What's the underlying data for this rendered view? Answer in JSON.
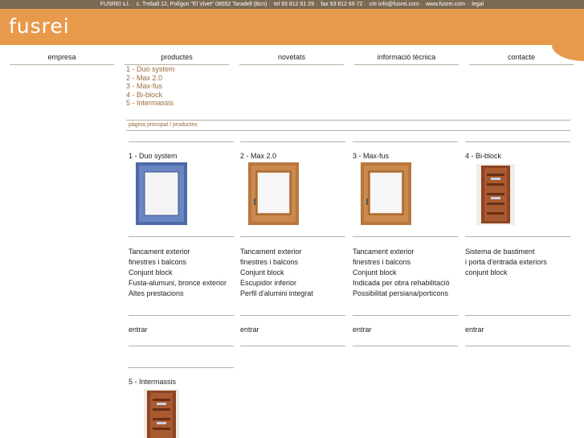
{
  "topbar": {
    "company": "FUSREI s.l.",
    "address": "c. Treball 12, Polígon \"El Vivet\" 08552 Taradell (Bcn)",
    "phone": "tel 93 812 61 29",
    "fax": "fax 93 812 69 72",
    "email": "c/e info@fusrei.com",
    "web": "www.fusrei.com",
    "legal": "legal"
  },
  "logo": "fusrei",
  "nav": [
    "empresa",
    "productes",
    "novetats",
    "informació tècnica",
    "contacte"
  ],
  "submenu": [
    "1 - Duo system",
    "2 - Max 2.0",
    "3 - Max-fus",
    "4 - Bi-block",
    "5 - Intermassis"
  ],
  "breadcrumb": "pàgina principal / productes",
  "products": [
    {
      "title": "1 - Duo system",
      "desc": [
        "Tancament exterior",
        "finestres i balcons",
        "Conjunt block",
        "Fusta-alumuni, bronce exterior",
        "Altes prestacions"
      ],
      "enter": "entrar",
      "image": "window-blue"
    },
    {
      "title": "2 - Max 2.0",
      "desc": [
        "Tancament exterior",
        "finestres i balcons",
        "Conjunt block",
        "Escupidor inferior",
        "Perfil d'alumini integrat"
      ],
      "enter": "entrar",
      "image": "window-wood"
    },
    {
      "title": "3 - Max-fus",
      "desc": [
        "Tancament exterior",
        "finestres i balcons",
        "Conjunt block",
        "Indicada per obra rehabilitació",
        "Possibilitat persiana/porticons"
      ],
      "enter": "entrar",
      "image": "window-wood"
    },
    {
      "title": "4 - Bi-block",
      "desc": [
        "Sistema de bastiment",
        "i porta d'entrada exteriors",
        "conjunt block"
      ],
      "enter": "entrar",
      "image": "door-wood"
    },
    {
      "title": "5 - Intermassis",
      "image": "door-wood"
    }
  ],
  "colors": {
    "banner": "#e89a4c",
    "topbar": "#7a6a52",
    "link": "#9b6b3b",
    "rule": "#b8b0a0"
  }
}
